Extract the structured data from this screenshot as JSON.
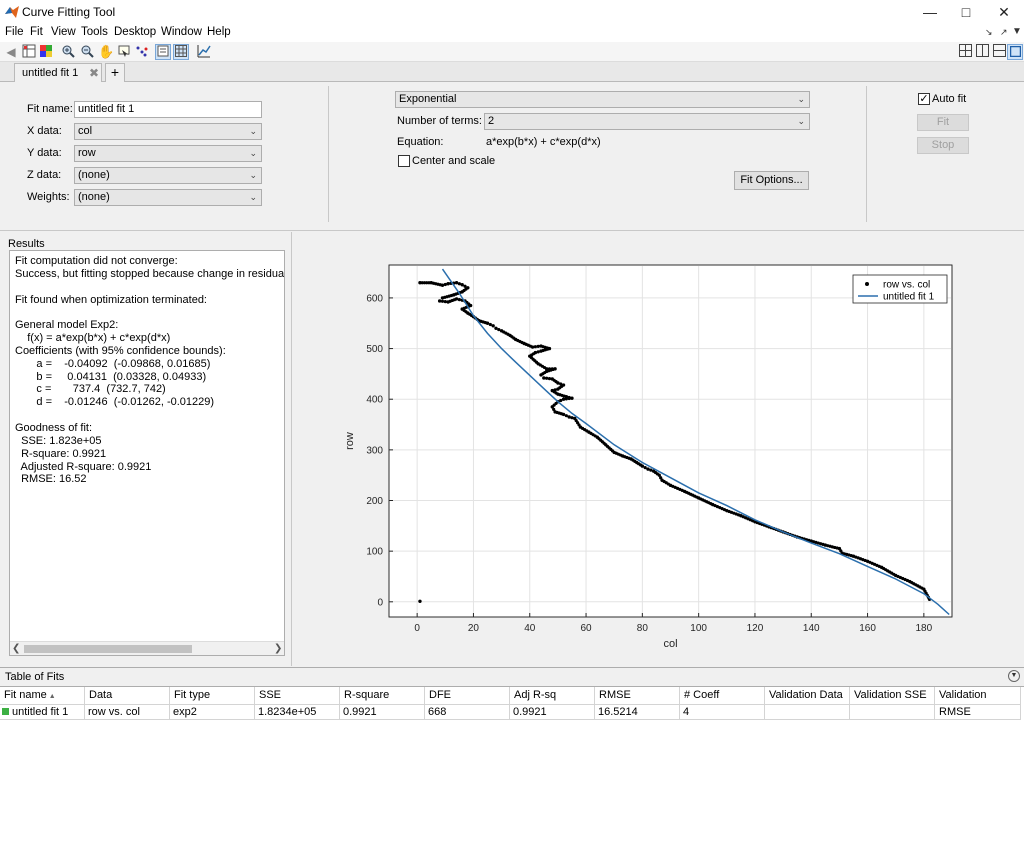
{
  "window": {
    "title": "Curve Fitting Tool"
  },
  "menu": [
    "File",
    "Fit",
    "View",
    "Tools",
    "Desktop",
    "Window",
    "Help"
  ],
  "tabs": [
    {
      "label": "untitled fit 1"
    }
  ],
  "fit_panel": {
    "fit_name_label": "Fit name:",
    "fit_name_value": "untitled fit 1",
    "x_label": "X data:",
    "x_value": "col",
    "y_label": "Y data:",
    "y_value": "row",
    "z_label": "Z data:",
    "z_value": "(none)",
    "w_label": "Weights:",
    "w_value": "(none)",
    "model_type": "Exponential",
    "terms_label": "Number of terms:",
    "terms_value": "2",
    "equation_label": "Equation:",
    "equation_value": "a*exp(b*x) + c*exp(d*x)",
    "center_scale_label": "Center and scale",
    "center_scale_checked": false,
    "fit_options_label": "Fit Options...",
    "auto_fit_label": "Auto fit",
    "auto_fit_checked": true,
    "fit_button": "Fit",
    "stop_button": "Stop"
  },
  "results": {
    "header": "Results",
    "lines": [
      "Fit computation did not converge:",
      "Success, but fitting stopped because change in residuals le",
      "",
      "Fit found when optimization terminated:",
      "",
      "General model Exp2:",
      "    f(x) = a*exp(b*x) + c*exp(d*x)",
      "Coefficients (with 95% confidence bounds):",
      "       a =    -0.04092  (-0.09868, 0.01685)",
      "       b =     0.04131  (0.03328, 0.04933)",
      "       c =       737.4  (732.7, 742)",
      "       d =    -0.01246  (-0.01262, -0.01229)",
      "",
      "Goodness of fit:",
      "  SSE: 1.823e+05",
      "  R-square: 0.9921",
      "  Adjusted R-square: 0.9921",
      "  RMSE: 16.52"
    ]
  },
  "chart_data": {
    "type": "scatter",
    "xlabel": "col",
    "ylabel": "row",
    "xlim": [
      -10,
      190
    ],
    "ylim": [
      -30,
      665
    ],
    "xticks": [
      0,
      20,
      40,
      60,
      80,
      100,
      120,
      140,
      160,
      180
    ],
    "yticks": [
      0,
      100,
      200,
      300,
      400,
      500,
      600
    ],
    "grid": true,
    "legend_position": "top-right",
    "series": [
      {
        "name": "row vs. col",
        "style": "points",
        "color": "#000000",
        "x": [
          1,
          1,
          5,
          9,
          11,
          14,
          16,
          18,
          16,
          13,
          9,
          8,
          11,
          14,
          17,
          19,
          16,
          18,
          20,
          22,
          25,
          27,
          28,
          30,
          33,
          35,
          38,
          41,
          44,
          47,
          44,
          42,
          40,
          43,
          46,
          49,
          46,
          44,
          45,
          48,
          50,
          52,
          50,
          48,
          50,
          53,
          55,
          52,
          50,
          48,
          49,
          52,
          54,
          56,
          58,
          61,
          64,
          67,
          70,
          73,
          76,
          78,
          80,
          82,
          84,
          86,
          87,
          90,
          95,
          100,
          105,
          110,
          115,
          120,
          125,
          130,
          135,
          140,
          145,
          150,
          151,
          155,
          160,
          165,
          170,
          175,
          180,
          182
        ],
        "y": [
          1,
          630,
          630,
          625,
          628,
          630,
          626,
          620,
          612,
          606,
          600,
          594,
          592,
          598,
          594,
          585,
          578,
          570,
          563,
          555,
          550,
          545,
          540,
          535,
          526,
          518,
          510,
          503,
          505,
          500,
          495,
          492,
          485,
          470,
          460,
          460,
          455,
          448,
          442,
          440,
          432,
          428,
          420,
          417,
          410,
          405,
          402,
          400,
          395,
          385,
          375,
          370,
          365,
          362,
          345,
          335,
          325,
          310,
          295,
          288,
          282,
          275,
          268,
          262,
          258,
          250,
          240,
          230,
          218,
          205,
          192,
          180,
          170,
          158,
          148,
          138,
          128,
          120,
          112,
          105,
          96,
          90,
          80,
          68,
          52,
          40,
          25,
          5
        ]
      },
      {
        "name": "untitled fit 1",
        "style": "line",
        "color": "#2b6fad",
        "x": [
          9,
          15,
          20,
          25,
          30,
          35,
          40,
          45,
          50,
          55,
          60,
          70,
          80,
          90,
          100,
          110,
          120,
          130,
          140,
          150,
          160,
          170,
          180,
          185,
          189
        ],
        "y": [
          657,
          609,
          565,
          530,
          500,
          473,
          447,
          421,
          395,
          372,
          352,
          310,
          275,
          245,
          215,
          190,
          162,
          138,
          116,
          95,
          70,
          45,
          16,
          -5,
          -25
        ]
      }
    ]
  },
  "table": {
    "header": "Table of Fits",
    "columns": [
      "Fit name",
      "Data",
      "Fit type",
      "SSE",
      "R-square",
      "DFE",
      "Adj R-sq",
      "RMSE",
      "# Coeff",
      "Validation Data",
      "Validation SSE",
      "Validation RMSE"
    ],
    "rows": [
      [
        "untitled fit 1",
        "row vs. col",
        "exp2",
        "1.8234e+05",
        "0.9921",
        "668",
        "0.9921",
        "16.5214",
        "4",
        "",
        "",
        ""
      ]
    ],
    "status_color": "#3cb043"
  }
}
